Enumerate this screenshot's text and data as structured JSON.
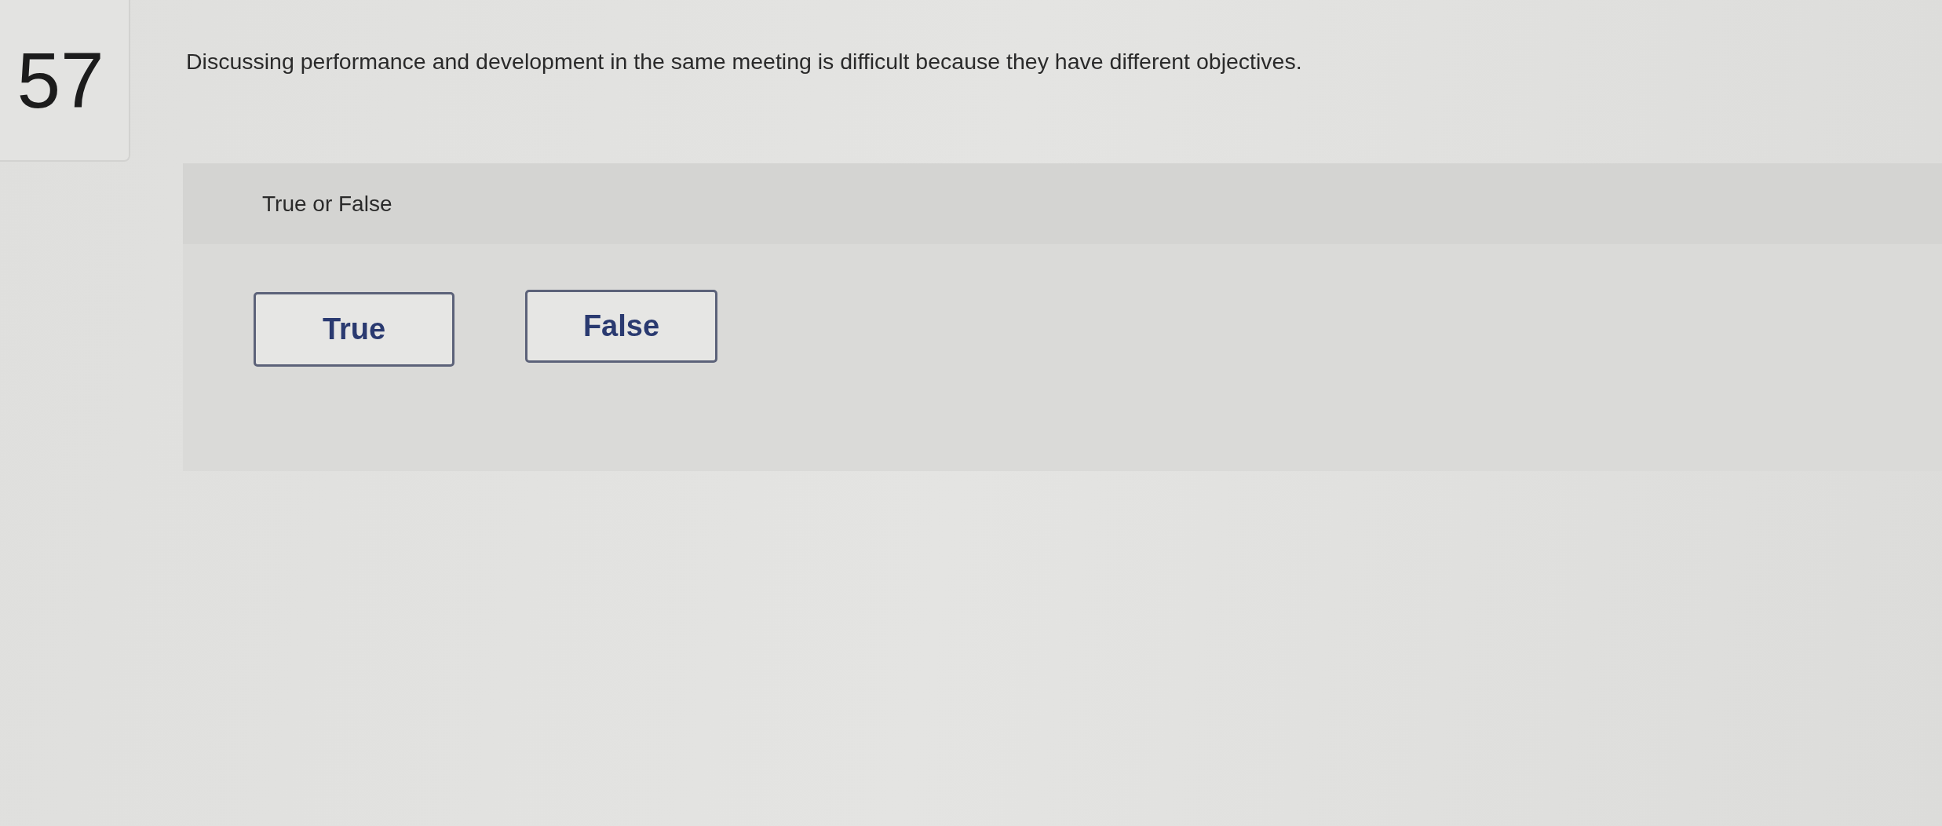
{
  "question": {
    "number": "57",
    "text": "Discussing performance and development in the same meeting is difficult because they have different objectives."
  },
  "answer_panel": {
    "prompt": "True or False",
    "choices": [
      {
        "label": "True",
        "selected": false
      },
      {
        "label": "False",
        "selected": false
      }
    ]
  }
}
